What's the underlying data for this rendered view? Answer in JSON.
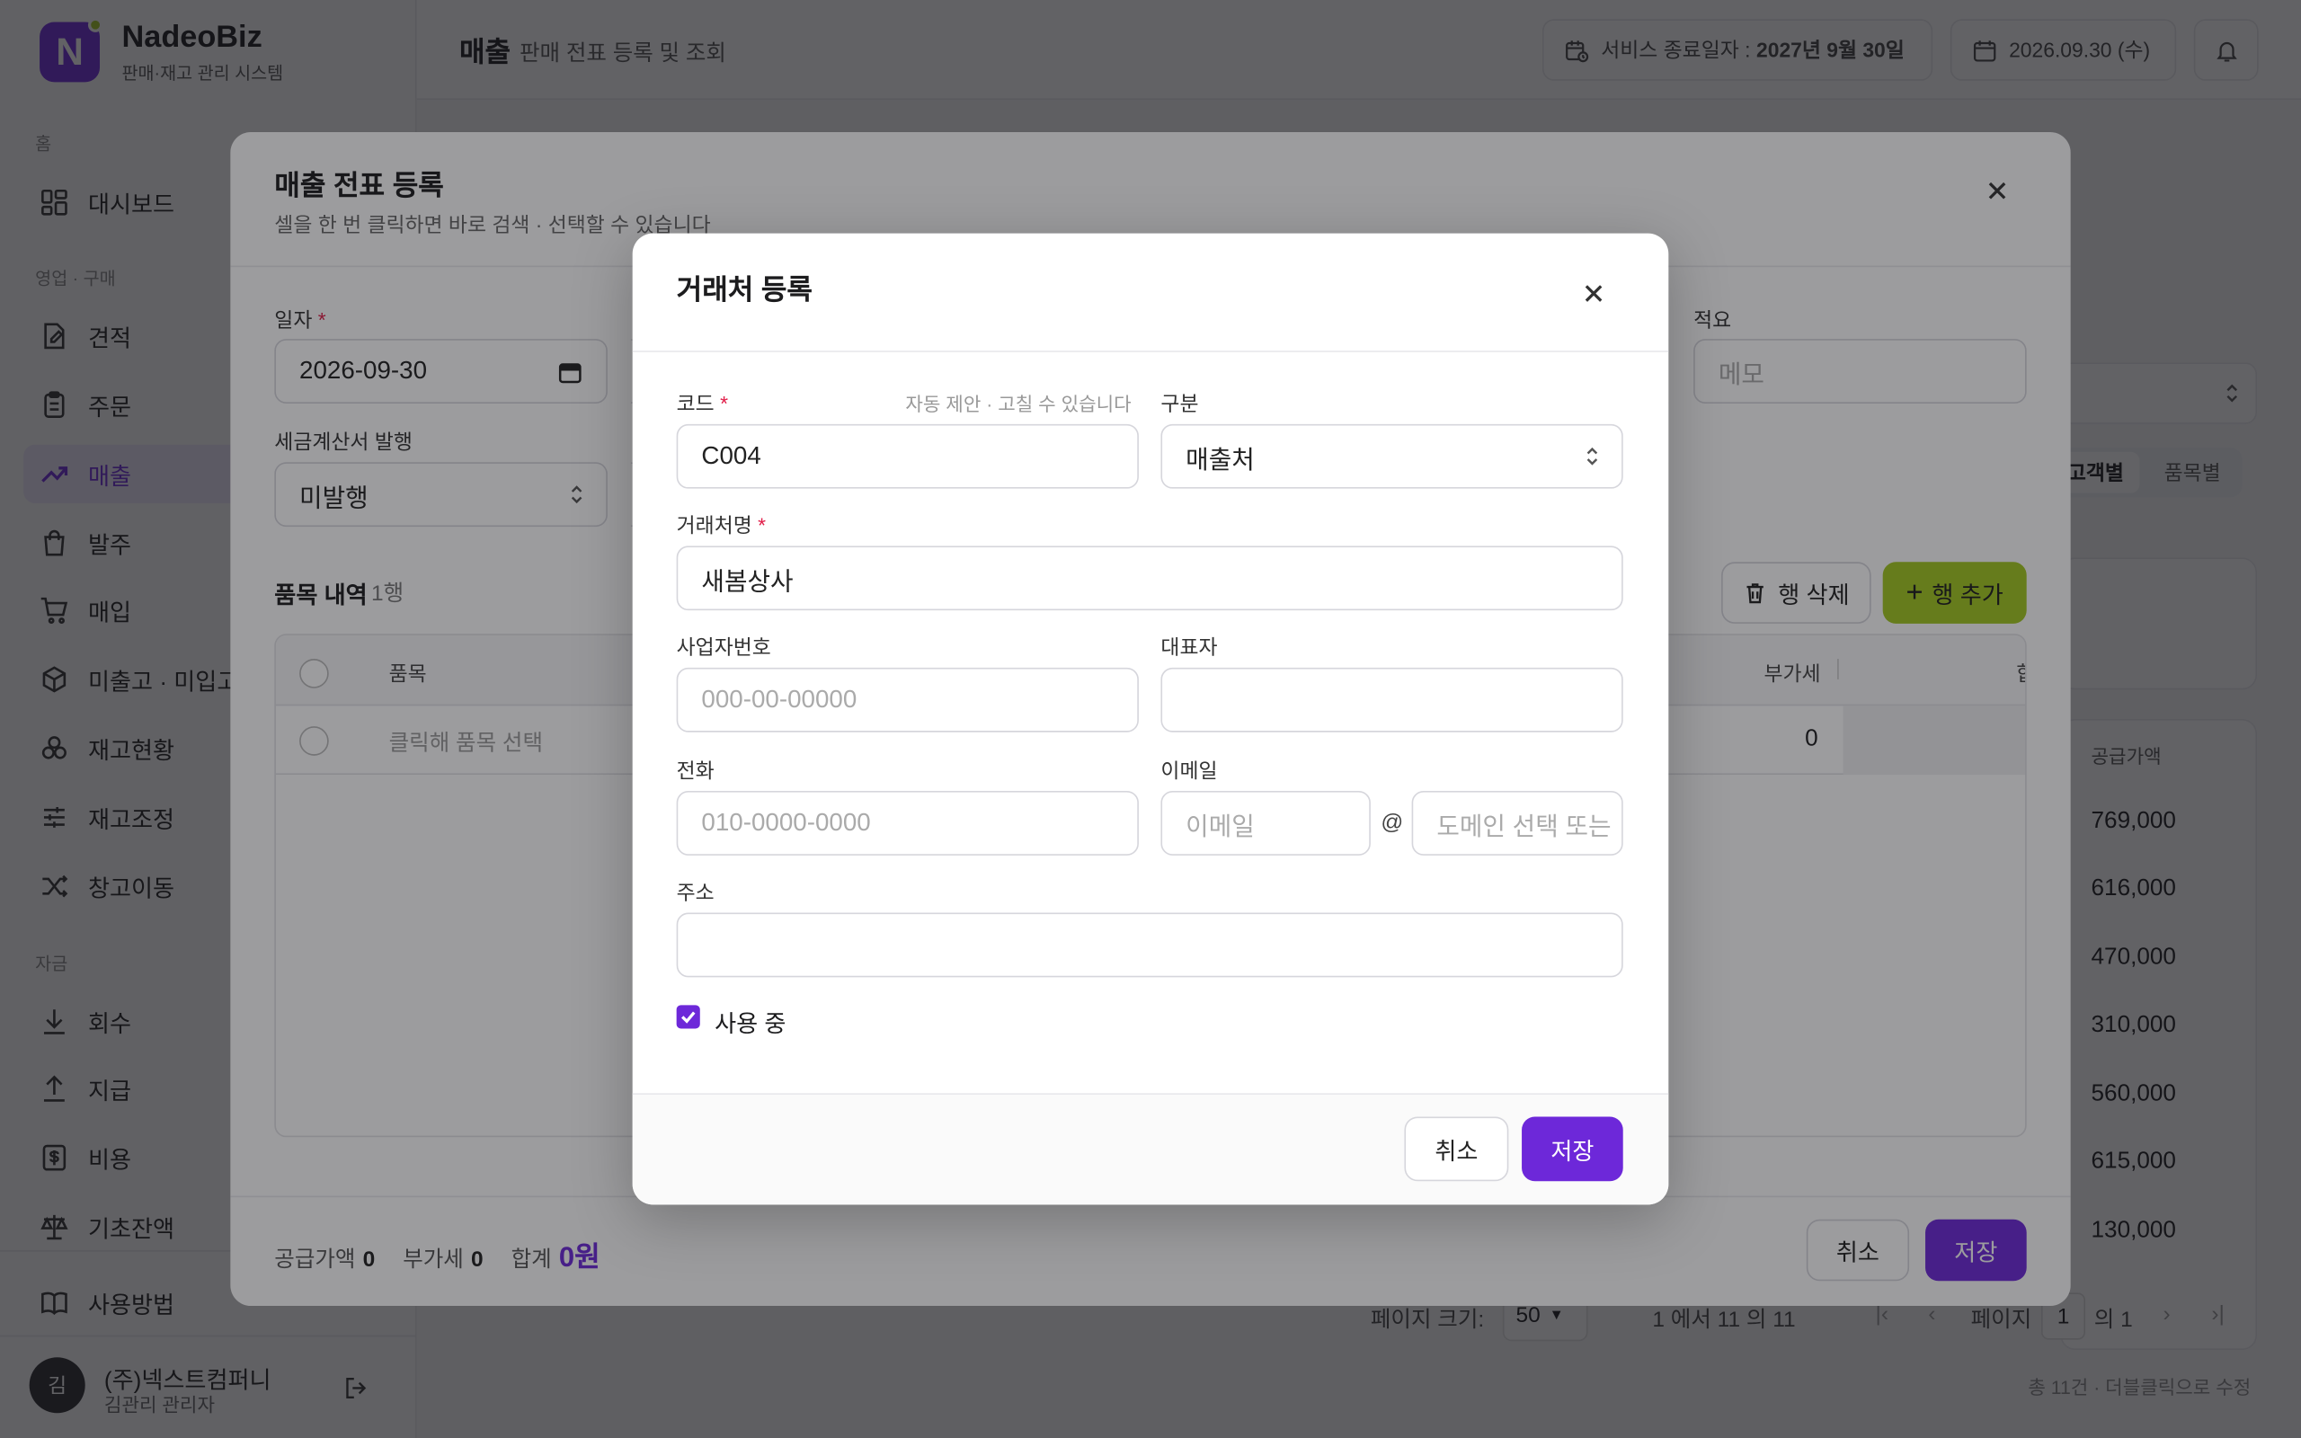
{
  "sidebar": {
    "brand": "NadeoBiz",
    "brand_logo_letter": "N",
    "brand_sub": "판매·재고 관리 시스템",
    "sections": [
      "홈",
      "영업 · 구매",
      "자금"
    ],
    "items": [
      {
        "label": "대시보드",
        "icon": "dashboard-icon"
      },
      {
        "label": "견적",
        "icon": "quote-icon"
      },
      {
        "label": "주문",
        "icon": "order-icon"
      },
      {
        "label": "매출",
        "icon": "trend-icon",
        "active": true
      },
      {
        "label": "발주",
        "icon": "bag-icon"
      },
      {
        "label": "매입",
        "icon": "cart-icon"
      },
      {
        "label": "미출고 · 미입고",
        "icon": "box-icon"
      },
      {
        "label": "재고현황",
        "icon": "boxes-icon"
      },
      {
        "label": "재고조정",
        "icon": "sliders-icon"
      },
      {
        "label": "창고이동",
        "icon": "shuffle-icon"
      },
      {
        "label": "회수",
        "icon": "download-icon"
      },
      {
        "label": "지급",
        "icon": "upload-icon"
      },
      {
        "label": "비용",
        "icon": "receipt-icon"
      },
      {
        "label": "기초잔액",
        "icon": "scale-icon"
      },
      {
        "label": "사용방법",
        "icon": "book-icon"
      }
    ],
    "user": {
      "avatar": "김",
      "company": "(주)넥스트컴퍼니",
      "name": "김관리 관리자"
    }
  },
  "topbar": {
    "title": "매출",
    "subtitle": "판매 전표 등록 및 조회",
    "service_end_label": "서비스 종료일자 :",
    "service_end_value": "2027년 9월 30일",
    "date": "2026.09.30 (수)"
  },
  "background": {
    "toggle_a": "고객별",
    "toggle_b": "품목별",
    "col_supply": "공급가액",
    "amounts": [
      "769,000",
      "616,000",
      "470,000",
      "310,000",
      "560,000",
      "615,000",
      "130,000"
    ],
    "page_size_label": "페이지 크기:",
    "page_size": "50",
    "range": "1 에서 11 의 11",
    "page_label": "페이지",
    "page": "1",
    "page_total": "의 1",
    "footer_note": "총 11건 · 더블클릭으로 수정"
  },
  "outer_modal": {
    "title": "매출 전표 등록",
    "subtitle": "셀을 한 번 클릭하면 바로 검색 · 선택할 수 있습니다",
    "date_label": "일자",
    "date_value": "2026-09-30",
    "memo_label": "적요",
    "memo_placeholder": "메모",
    "tax_label": "세금계산서 발행",
    "tax_value": "미발행",
    "items_title": "품목 내역",
    "items_count": "1행",
    "delete_row": "행 삭제",
    "add_row": "행 추가",
    "col_item": "품목",
    "col_vat": "부가세",
    "col_total": "합",
    "row_placeholder": "클릭해 품목 선택",
    "row_vat": "0",
    "sum_supply_label": "공급가액",
    "sum_supply": "0",
    "sum_vat_label": "부가세",
    "sum_vat": "0",
    "sum_total_label": "합계",
    "sum_total": "0원",
    "cancel": "취소",
    "save": "저장"
  },
  "inner_modal": {
    "title": "거래처 등록",
    "code_label": "코드",
    "code_hint": "자동 제안 · 고칠 수 있습니다",
    "code_value": "C004",
    "type_label": "구분",
    "type_value": "매출처",
    "name_label": "거래처명",
    "name_value": "새봄상사",
    "bizno_label": "사업자번호",
    "bizno_placeholder": "000-00-00000",
    "ceo_label": "대표자",
    "phone_label": "전화",
    "phone_placeholder": "010-0000-0000",
    "email_label": "이메일",
    "email_placeholder": "이메일",
    "at": "@",
    "domain_placeholder": "도메인 선택 또는",
    "address_label": "주소",
    "active_label": "사용 중",
    "cancel": "취소",
    "save": "저장"
  },
  "colors": {
    "primary": "#6d28d9",
    "accent_green": "#a3c81f",
    "required": "#e11d48"
  }
}
